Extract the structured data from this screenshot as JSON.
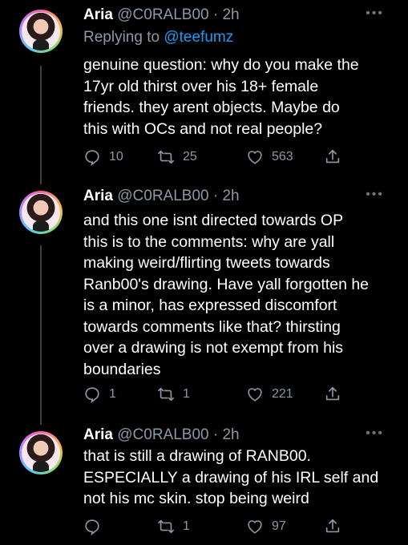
{
  "tweets": [
    {
      "name": "Aria",
      "handle": "@C0RALB00",
      "sep": "·",
      "time": "2h",
      "reply_prefix": "Replying to ",
      "reply_handle": "@teefumz",
      "text": "genuine question: why do you make the\n17yr old thirst over his 18+ female\nfriends. they arent objects. Maybe do\nthis with OCs and not real people?",
      "replies": "10",
      "retweets": "25",
      "likes": "563"
    },
    {
      "name": "Aria",
      "handle": "@C0RALB00",
      "sep": "·",
      "time": "2h",
      "text": "and this one isnt directed towards OP\nthis is to the comments: why are yall\nmaking weird/flirting tweets towards\nRanb00's drawing. Have yall forgotten he\nis a minor, has expressed discomfort\ntowards comments like that? thirsting\nover a drawing is not exempt from his\nboundaries",
      "replies": "1",
      "retweets": "1",
      "likes": "221"
    },
    {
      "name": "Aria",
      "handle": "@C0RALB00",
      "sep": "·",
      "time": "2h",
      "text": "that is still a drawing of RANB00.\nESPECIALLY a drawing of his IRL self and\nnot his mc skin. stop being weird",
      "replies": "",
      "retweets": "1",
      "likes": "97"
    }
  ],
  "icons": {
    "reply": "reply-icon",
    "retweet": "retweet-icon",
    "like": "heart-icon",
    "share": "share-icon",
    "more": "more-icon"
  },
  "colors": {
    "background": "#000000",
    "text": "#ffffff",
    "secondary": "#8b98a5",
    "link": "#1d9bf0"
  }
}
